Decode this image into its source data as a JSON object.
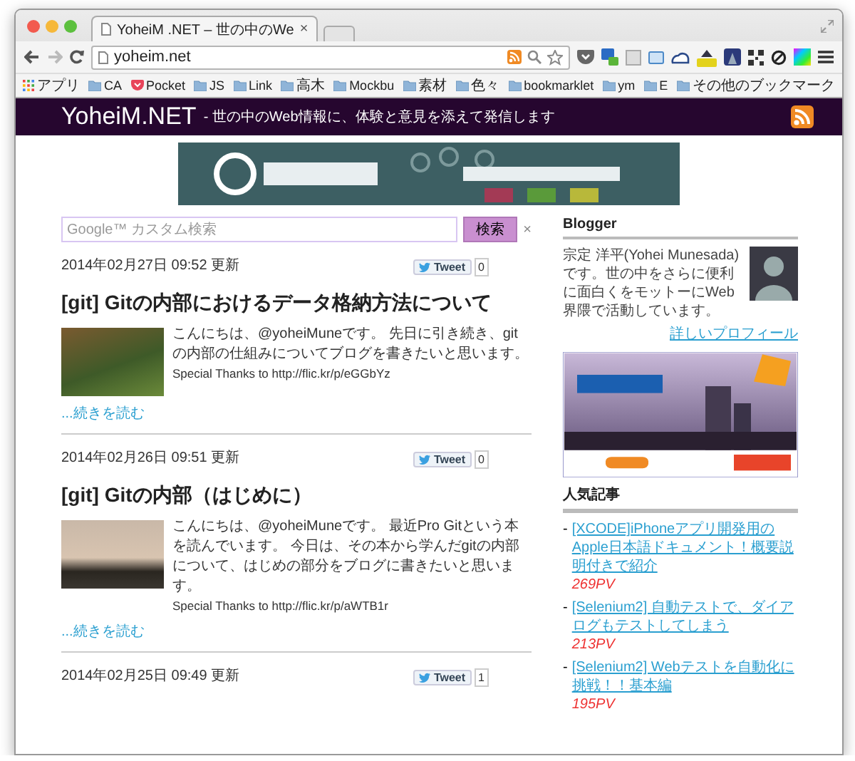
{
  "browser": {
    "tab": {
      "title": "YoheiM .NET – 世の中のWe",
      "close": "×"
    },
    "address": "yoheim.net",
    "bookmarks": [
      {
        "label": "アプリ",
        "kind": "apps"
      },
      {
        "label": "CA",
        "kind": "folder"
      },
      {
        "label": "Pocket",
        "kind": "pocket"
      },
      {
        "label": "JS",
        "kind": "folder"
      },
      {
        "label": "Link",
        "kind": "folder"
      },
      {
        "label": "高木",
        "kind": "folder"
      },
      {
        "label": "Mockbu",
        "kind": "folder"
      },
      {
        "label": "素材",
        "kind": "folder"
      },
      {
        "label": "色々",
        "kind": "folder"
      },
      {
        "label": "bookmarklet",
        "kind": "folder"
      },
      {
        "label": "ym",
        "kind": "folder"
      },
      {
        "label": "E",
        "kind": "folder"
      }
    ],
    "other_bookmarks": "その他のブックマーク"
  },
  "site": {
    "title": "YoheiM.NET",
    "tagline": "- 世の中のWeb情報に、体験と意見を添えて発信します"
  },
  "search": {
    "placeholder": "Google™ カスタム検索",
    "button": "検索",
    "clear": "×"
  },
  "posts": [
    {
      "date": "2014年02月27日 09:52 更新",
      "tweet": "Tweet",
      "tweet_count": "0",
      "title": "[git] Gitの内部におけるデータ格納方法について",
      "excerpt": "こんにちは、@yoheiMuneです。 先日に引き続き、gitの内部の仕組みについてブログを書きたいと思います。",
      "credit": "Special Thanks to http://flic.kr/p/eGGbYz",
      "read_more": "...続きを読む"
    },
    {
      "date": "2014年02月26日 09:51 更新",
      "tweet": "Tweet",
      "tweet_count": "0",
      "title": "[git] Gitの内部（はじめに）",
      "excerpt": "こんにちは、@yoheiMuneです。 最近Pro Gitという本を読んでいます。 今日は、その本から学んだgitの内部について、はじめの部分をブログに書きたいと思います。",
      "credit": "Special Thanks to http://flic.kr/p/aWTB1r",
      "read_more": "...続きを読む"
    },
    {
      "date": "2014年02月25日 09:49 更新",
      "tweet": "Tweet",
      "tweet_count": "1"
    }
  ],
  "sidebar": {
    "blogger": {
      "heading": "Blogger",
      "bio": "宗定 洋平(Yohei Munesada)です。世の中をさらに便利に面白くをモットーにWeb界隈で活動しています。",
      "profile_link": "詳しいプロフィール"
    },
    "popular": {
      "heading": "人気記事",
      "items": [
        {
          "marker": "-",
          "title": "[XCODE]iPhoneアプリ開発用のApple日本語ドキュメント！概要説明付きで紹介",
          "views": "269PV"
        },
        {
          "marker": "-",
          "title": "[Selenium2] 自動テストで、ダイアログもテストしてしまう",
          "views": "213PV"
        },
        {
          "marker": "-",
          "title": "[Selenium2] Webテストを自動化に挑戦！！基本編",
          "views": "195PV"
        }
      ]
    }
  }
}
